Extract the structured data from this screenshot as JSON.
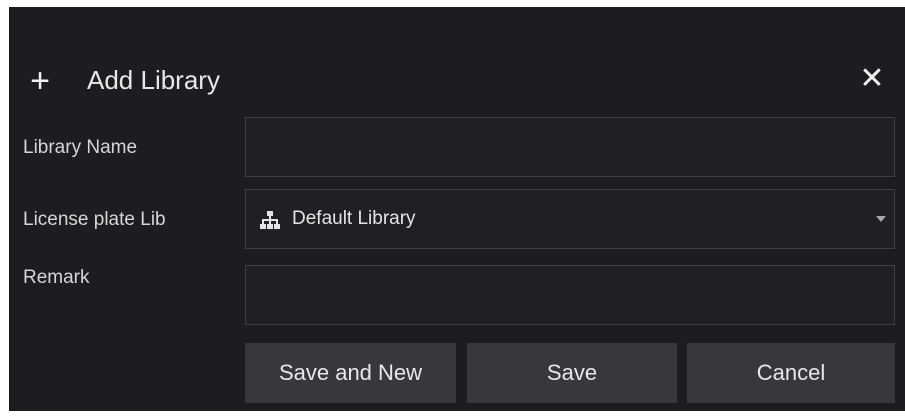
{
  "dialog": {
    "title": "Add Library",
    "icons": {
      "title": "plus-icon",
      "close": "close-icon",
      "library": "tree-icon",
      "dropdown": "chevron-down-icon"
    },
    "colors": {
      "background": "#1c1d21",
      "field_border": "#3e3f44",
      "button": "#37383d",
      "text": "#e8e8e8"
    }
  },
  "form": {
    "library_name": {
      "label": "Library Name",
      "value": "",
      "placeholder": ""
    },
    "license_plate_lib": {
      "label": "License plate Lib",
      "selected": "Default Library"
    },
    "remark": {
      "label": "Remark",
      "value": "",
      "placeholder": ""
    }
  },
  "buttons": {
    "save_and_new": "Save and New",
    "save": "Save",
    "cancel": "Cancel"
  }
}
